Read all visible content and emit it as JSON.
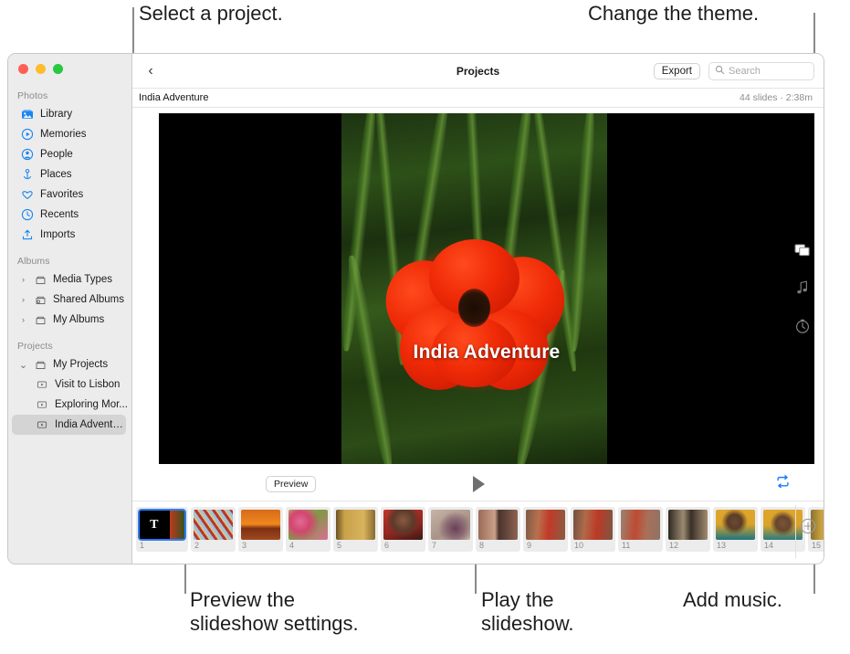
{
  "callouts": {
    "select_project": "Select a project.",
    "change_theme": "Change the theme.",
    "preview_settings": "Preview the\nslideshow settings.",
    "play_slideshow": "Play the\nslideshow.",
    "add_music": "Add music."
  },
  "window": {
    "traffic_lights": [
      "close",
      "minimize",
      "zoom"
    ]
  },
  "sidebar": {
    "sections": [
      {
        "title": "Photos",
        "items": [
          {
            "label": "Library",
            "icon": "library-icon"
          },
          {
            "label": "Memories",
            "icon": "memories-icon"
          },
          {
            "label": "People",
            "icon": "people-icon"
          },
          {
            "label": "Places",
            "icon": "places-icon"
          },
          {
            "label": "Favorites",
            "icon": "favorites-icon"
          },
          {
            "label": "Recents",
            "icon": "recents-icon"
          },
          {
            "label": "Imports",
            "icon": "imports-icon"
          }
        ]
      },
      {
        "title": "Albums",
        "items": [
          {
            "label": "Media Types",
            "icon": "folder-icon",
            "twisty": "›"
          },
          {
            "label": "Shared Albums",
            "icon": "shared-folder-icon",
            "twisty": "›"
          },
          {
            "label": "My Albums",
            "icon": "folder-icon",
            "twisty": "›"
          }
        ]
      },
      {
        "title": "Projects",
        "items": [
          {
            "label": "My Projects",
            "icon": "folder-icon",
            "twisty": "⌄"
          },
          {
            "label": "Visit to Lisbon",
            "icon": "slideshow-icon"
          },
          {
            "label": "Exploring Mor...",
            "icon": "slideshow-icon"
          },
          {
            "label": "India Adventure",
            "icon": "slideshow-icon",
            "selected": true
          }
        ]
      }
    ]
  },
  "toolbar": {
    "back_icon": "back-chevron-icon",
    "title": "Projects",
    "export_label": "Export",
    "search_icon": "search-icon",
    "search_placeholder": "Search",
    "search_value": ""
  },
  "subbar": {
    "project_name": "India Adventure",
    "meta": "44 slides · 2:38m"
  },
  "preview": {
    "slide_title": "India Adventure"
  },
  "rail": [
    {
      "name": "theme-icon",
      "label": "Themes"
    },
    {
      "name": "music-note-icon",
      "label": "Music"
    },
    {
      "name": "duration-timer-icon",
      "label": "Duration"
    }
  ],
  "playback": {
    "preview_label": "Preview",
    "play_icon": "play-icon",
    "loop_icon": "loop-repeat-icon",
    "loop_color": "#1a7bff",
    "loop_active": true
  },
  "filmstrip": {
    "add_icon": "add-slide-icon",
    "slides": [
      {
        "num": "1",
        "kind": "title",
        "letter": "T",
        "selected": true,
        "c1": "#000000",
        "c2": "#000000"
      },
      {
        "num": "2",
        "kind": "photo",
        "c1": "#8fb8d8",
        "c2": "#b03a28"
      },
      {
        "num": "3",
        "kind": "photo",
        "c1": "#e2641a",
        "c2": "#8c3a14"
      },
      {
        "num": "4",
        "kind": "photo",
        "c1": "#d9547f",
        "c2": "#b8c46a"
      },
      {
        "num": "5",
        "kind": "photo",
        "c1": "#c9a24a",
        "c2": "#6b5226"
      },
      {
        "num": "6",
        "kind": "photo",
        "c1": "#b8322c",
        "c2": "#5c2a22"
      },
      {
        "num": "7",
        "kind": "photo",
        "c1": "#b9a79a",
        "c2": "#6a4f5e"
      },
      {
        "num": "8",
        "kind": "photo",
        "c1": "#9a6b58",
        "c2": "#43322c"
      },
      {
        "num": "9",
        "kind": "photo",
        "c1": "#b24a33",
        "c2": "#6d4a38"
      },
      {
        "num": "10",
        "kind": "photo",
        "c1": "#a8402f",
        "c2": "#6b4a3a"
      },
      {
        "num": "11",
        "kind": "photo",
        "c1": "#bc4430",
        "c2": "#7a5e52"
      },
      {
        "num": "12",
        "kind": "photo",
        "c1": "#8a7b68",
        "c2": "#3a3028"
      },
      {
        "num": "13",
        "kind": "photo",
        "c1": "#d9a32a",
        "c2": "#1d6e78"
      },
      {
        "num": "14",
        "kind": "photo",
        "c1": "#d9a32a",
        "c2": "#2a7a80"
      },
      {
        "num": "15",
        "kind": "photo",
        "c1": "#c9748f",
        "c2": "#7a5a2a"
      }
    ]
  }
}
